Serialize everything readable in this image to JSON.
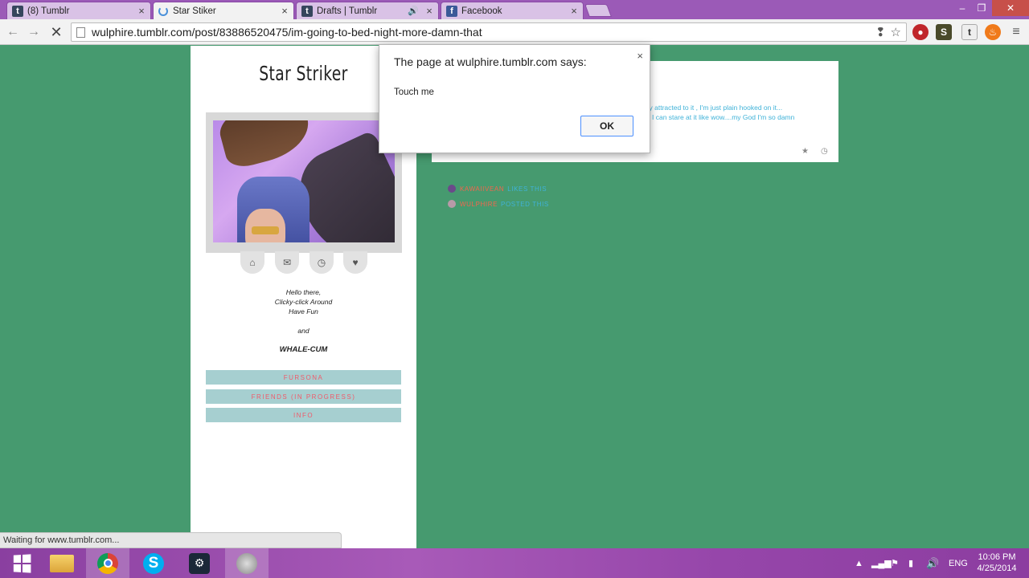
{
  "browser": {
    "tabs": [
      {
        "label": "(8) Tumblr",
        "icon": "t",
        "icon_color": "#36465d"
      },
      {
        "label": "Star Stiker",
        "icon": "loading-spinner"
      },
      {
        "label": "Drafts | Tumblr",
        "icon": "t",
        "icon_color": "#36465d",
        "audio": "🔊"
      },
      {
        "label": "Facebook",
        "icon": "f",
        "icon_color": "#3b5998"
      }
    ],
    "url": "wulphire.tumblr.com/post/83886520475/im-going-to-bed-night-more-damn-that",
    "status_text": "Waiting for www.tumblr.com..."
  },
  "sidebar": {
    "blog_title": "Star Striker",
    "bio_lines": [
      "Hello there,",
      "Clicky-click Around",
      "Have Fun"
    ],
    "bio_and": "and",
    "bio_bold": "WHALE-CUM",
    "links": [
      "FURSONA",
      "FRIENDS (IN PROGRESS)",
      "INFO"
    ]
  },
  "post": {
    "line1": "ally attracted to it , I'm just plain hooked on it...",
    "line2": "I can stare at it like wow....my God I'm so damn"
  },
  "notes": [
    {
      "user": "KAWAIIVEAN",
      "action": "LIKES THIS",
      "avatar_color": "#6a4a8a"
    },
    {
      "user": "WULPHIRE",
      "action": "POSTED THIS",
      "avatar_color": "#b89aa8"
    }
  ],
  "dialog": {
    "title": "The page at wulphire.tumblr.com says:",
    "message": "Touch me",
    "ok_label": "OK",
    "close_glyph": "×"
  },
  "taskbar": {
    "language": "ENG",
    "time": "10:06 PM",
    "date": "4/25/2014"
  }
}
